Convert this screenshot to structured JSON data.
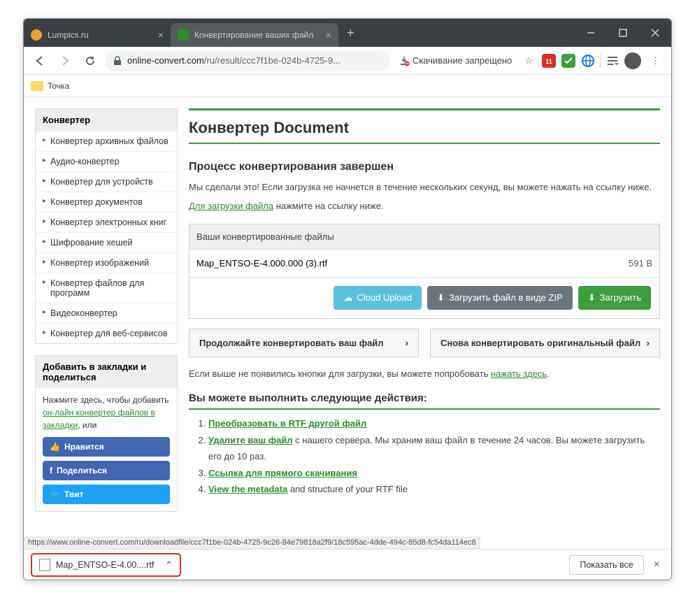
{
  "tabs": [
    {
      "title": "Lumpics.ru",
      "icon_color": "#f0a030"
    },
    {
      "title": "Конвертирование ваших файл",
      "icon_color": "#2e8b2e"
    }
  ],
  "url": {
    "host": "online-convert.com",
    "path": "/ru/result/ccc7f1be-024b-4725-9..."
  },
  "download_status": "Скачивание запрещено",
  "bookmark": "Точка",
  "sidebar": {
    "title": "Конвертер",
    "items": [
      "Конвертер архивных файлов",
      "Аудио-конвертер",
      "Конвертер для устройств",
      "Конвертер документов",
      "Конвертер электронных книг",
      "Шифрование хешей",
      "Конвертер изображений",
      "Конвертер файлов для программ",
      "Видеоконвертер",
      "Конвертер для веб-сервисов"
    ],
    "bookmark_title": "Добавить в закладки и поделиться",
    "bookmark_text_before": "Нажмите здесь, чтобы добавить ",
    "bookmark_link": "он-лайн конвертер файлов в закладки",
    "bookmark_text_after": ", или",
    "social": {
      "like": "Нравится",
      "share": "Поделиться",
      "tweet": "Твит"
    }
  },
  "main": {
    "title": "Конвертер Document",
    "done_title": "Процесс конвертирования завершен",
    "done_p1": "Мы сделали это! Если загрузка не начнется в течение нескольких секунд, вы можете нажать на ссылку ниже.",
    "done_link": "Для загрузки файла",
    "done_p2": " нажмите на ссылку ниже.",
    "files_head": "Ваши конвертированные файлы",
    "file_name": "Map_ENTSO-E-4.000.000 (3).rtf",
    "file_size": "591 B",
    "cloud": "Cloud Upload",
    "zip": "Загрузить файл в виде ZIP",
    "download": "Загрузить",
    "continue": "Продолжайте конвертировать ваш файл",
    "again": "Снова конвертировать оригинальный файл",
    "fallback_before": "Если выше не появились кнопки для загрузки, вы можете попробовать ",
    "fallback_link": "нажать здесь",
    "actions_title": "Вы можете выполнить следующие действия:",
    "steps": {
      "s1": "Преобразовать в RTF другой файл",
      "s2a": "Удалите ваш файл",
      "s2b": " с нашего сервера. Мы храним ваш файл в течение 24 часов. Вы можете загрузить его до 10 раз.",
      "s3": "Ссылка для прямого скачивания",
      "s4a": "View the metadata",
      "s4b": " and structure of your RTF file"
    }
  },
  "status_url": "https://www.online-convert.com/ru/downloadfile/ccc7f1be-024b-4725-9c26-84e79818a2f9/18c595ac-4dde-494c-85d8-fc54da114ec8",
  "dl_chip": "Map_ENTSO-E-4.00....rtf",
  "show_all": "Показать все"
}
